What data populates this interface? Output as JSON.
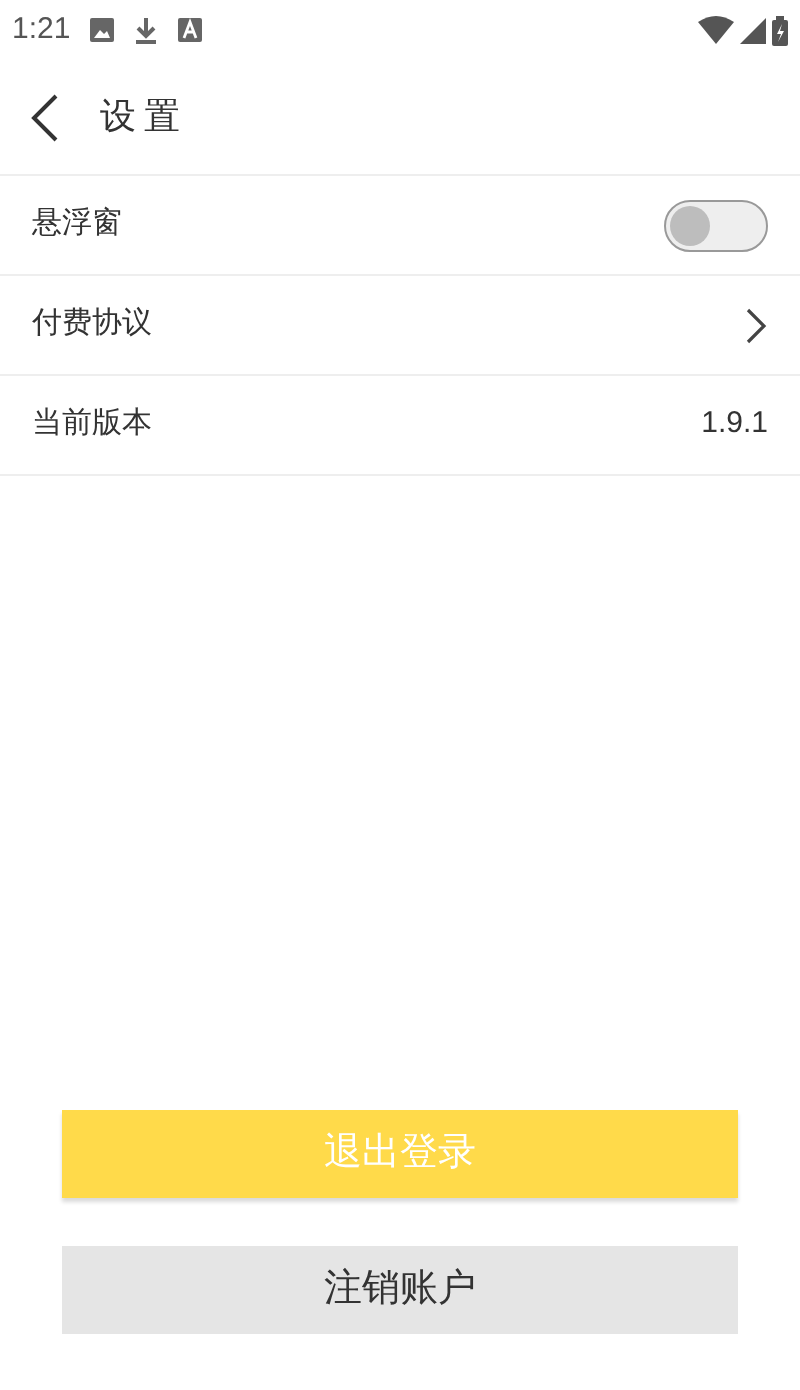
{
  "status_bar": {
    "time": "1:21"
  },
  "header": {
    "title": "设置"
  },
  "rows": [
    {
      "kind": "toggle",
      "label": "悬浮窗",
      "on": false
    },
    {
      "kind": "link",
      "label": "付费协议"
    },
    {
      "kind": "value",
      "label": "当前版本",
      "value": "1.9.1"
    }
  ],
  "buttons": [
    {
      "kind": "primary",
      "label": "退出登录"
    },
    {
      "kind": "secondary",
      "label": "注销账户"
    }
  ]
}
